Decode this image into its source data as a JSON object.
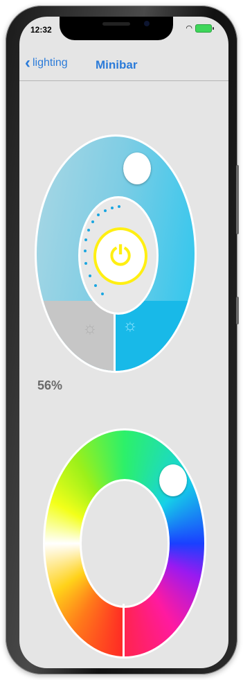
{
  "status_bar": {
    "time": "12:32",
    "wifi_icon": "wifi-icon",
    "battery_icon": "battery-icon"
  },
  "navbar": {
    "back_label": "lighting",
    "back_icon": "chevron-left-icon",
    "title": "Minibar"
  },
  "brightness": {
    "percent_label": "56%",
    "power_icon": "power-icon",
    "dim_icon": "sun-dim-icon",
    "bright_icon": "sun-bright-icon",
    "colors": {
      "ring": "#7fcde4",
      "active": "#18b9e8",
      "power": "#ffef12"
    }
  },
  "color_wheel": {
    "selected_hint": "blue"
  }
}
